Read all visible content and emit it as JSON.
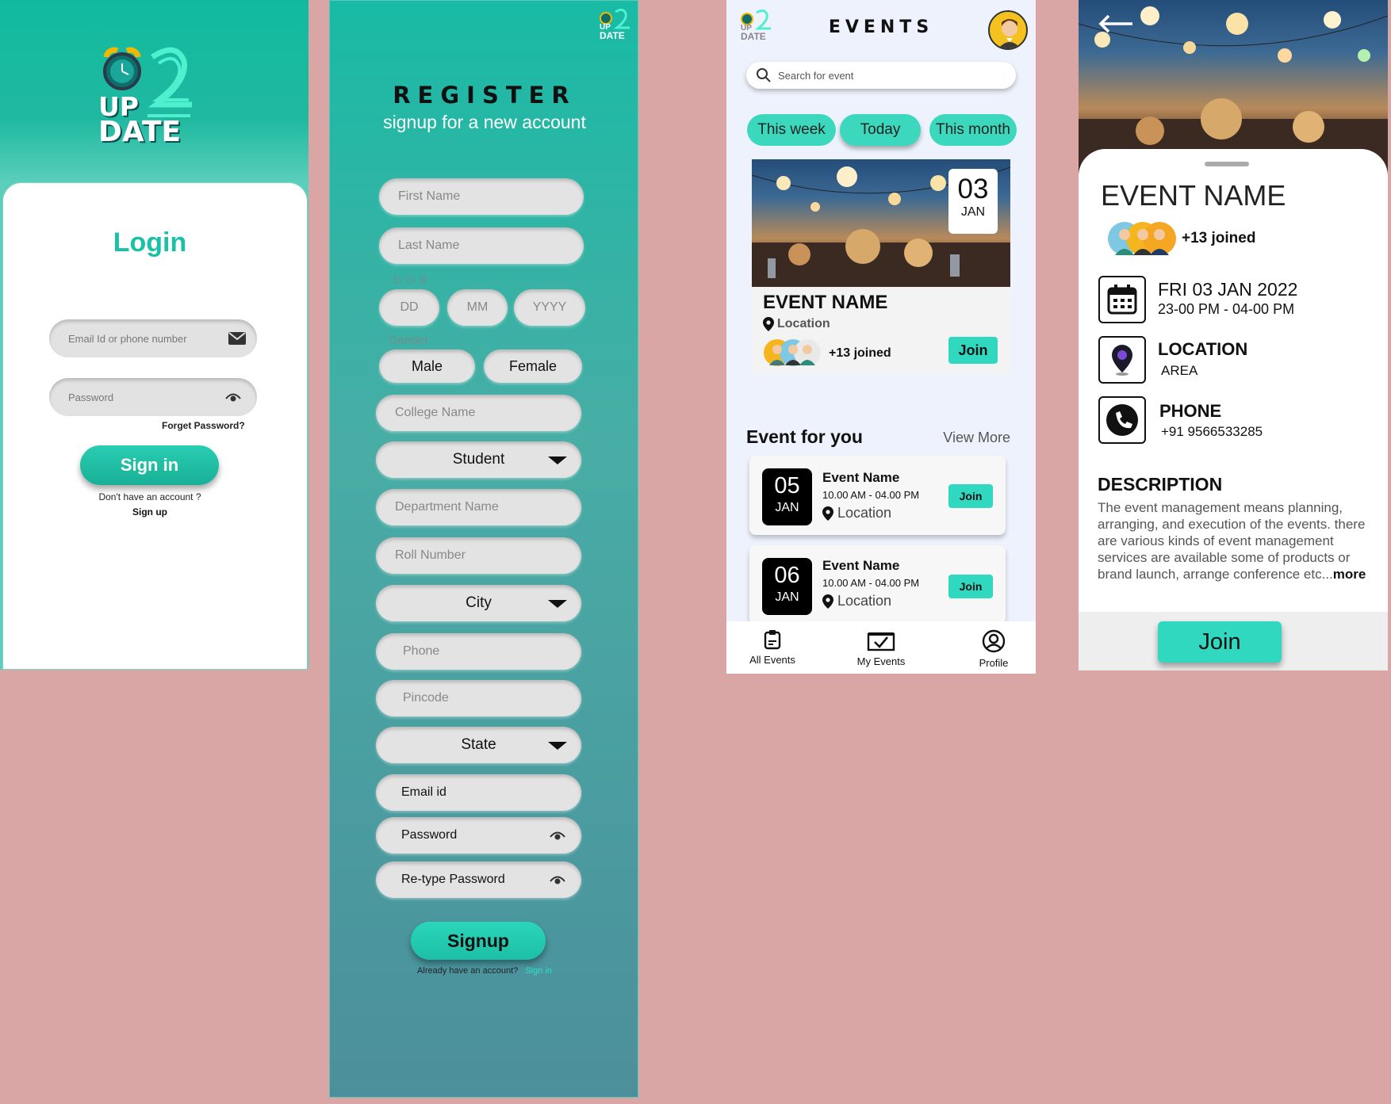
{
  "logo": {
    "up": "UP",
    "date": "DATE",
    "two": "2"
  },
  "login": {
    "title": "Login",
    "email_placeholder": "Email Id or phone number",
    "password_placeholder": "Password",
    "forget_password": "Forget Password?",
    "sign_in_label": "Sign in",
    "no_account_text": "Don't have an account ?",
    "sign_up_link": "Sign up"
  },
  "register": {
    "title": "REGISTER",
    "subtitle": "signup for a new account",
    "first_name": "First Name",
    "last_name": "Last Name",
    "dob_label": "D O B",
    "dd": "DD",
    "mm": "MM",
    "yyyy": "YYYY",
    "gender_label": "Gender",
    "male": "Male",
    "female": "Female",
    "college": "College Name",
    "role_value": "Student",
    "department": "Department Name",
    "roll": "Roll Number",
    "city_value": "City",
    "phone": "Phone",
    "pincode": "Pincode",
    "state_value": "State",
    "email": "Email id",
    "password": "Password",
    "retype_password": "Re-type Password",
    "signup_label": "Signup",
    "already_text": "Already have an account?",
    "sign_in_link": "Sign in"
  },
  "events": {
    "title": "EVENTS",
    "search_placeholder": "Search for event",
    "filters": [
      "This week",
      "Today",
      "This month"
    ],
    "featured": {
      "day": "03",
      "month": "JAN",
      "name": "EVENT NAME",
      "location": "Location",
      "joined": "+13 joined",
      "join_label": "Join"
    },
    "section_title": "Event for you",
    "view_more": "View More",
    "list": [
      {
        "day": "05",
        "month": "JAN",
        "name": "Event Name",
        "time": "10.00 AM - 04.00 PM",
        "location": "Location",
        "join_label": "Join"
      },
      {
        "day": "06",
        "month": "JAN",
        "name": "Event Name",
        "time": "10.00 AM - 04.00 PM",
        "location": "Location",
        "join_label": "Join"
      }
    ],
    "nav": [
      "All Events",
      "My Events",
      "Profile"
    ]
  },
  "details": {
    "name": "EVENT NAME",
    "joined": "+13 joined",
    "date": "FRI 03 JAN 2022",
    "time": "23-00 PM - 04-00 PM",
    "location_label": "LOCATION",
    "location_value": "AREA",
    "phone_label": "PHONE",
    "phone_value": "+91 9566533285",
    "description_title": "DESCRIPTION",
    "description_text": "The event management means planning, arranging, and execution of the events. there are various kinds of event management services are available some of products or brand launch, arrange conference etc...",
    "more": "more",
    "join_label": "Join"
  },
  "colors": {
    "teal": "#1fbfa5",
    "join": "#2fd8bf",
    "background": "#d9a5a5"
  }
}
